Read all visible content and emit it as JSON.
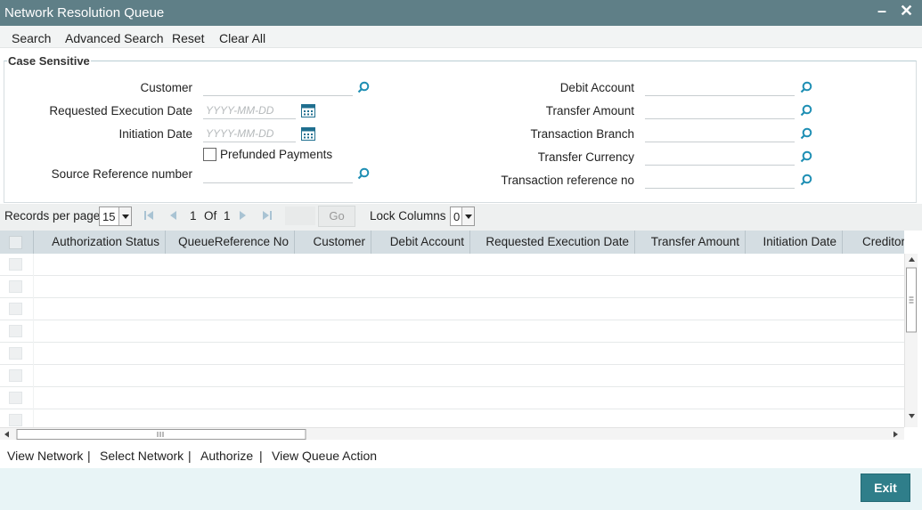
{
  "window": {
    "title": "Network Resolution Queue",
    "minimize": "–",
    "close": "✕"
  },
  "menu": {
    "search": "Search",
    "advanced_search": "Advanced Search",
    "reset": "Reset",
    "clear_all": "Clear All"
  },
  "criteria": {
    "legend": "Case Sensitive",
    "customer": {
      "label": "Customer",
      "value": ""
    },
    "requested_execution_date": {
      "label": "Requested Execution Date",
      "placeholder": "YYYY-MM-DD"
    },
    "initiation_date": {
      "label": "Initiation Date",
      "placeholder": "YYYY-MM-DD"
    },
    "prefunded_payments": {
      "label": "Prefunded Payments",
      "checked": false
    },
    "source_reference_number": {
      "label": "Source Reference number",
      "value": ""
    },
    "debit_account": {
      "label": "Debit Account",
      "value": ""
    },
    "transfer_amount": {
      "label": "Transfer Amount",
      "value": ""
    },
    "transaction_branch": {
      "label": "Transaction Branch",
      "value": ""
    },
    "transfer_currency": {
      "label": "Transfer Currency",
      "value": ""
    },
    "transaction_reference_no": {
      "label": "Transaction reference no",
      "value": ""
    }
  },
  "pagination": {
    "records_per_page_label": "Records per page",
    "records_per_page": "15",
    "current_page": "1",
    "of_label": "Of",
    "total_pages": "1",
    "go_label": "Go",
    "lock_columns_label": "Lock Columns",
    "lock_columns": "0"
  },
  "grid": {
    "columns": [
      "Authorization Status",
      "QueueReference No",
      "Customer",
      "Debit Account",
      "Requested Execution Date",
      "Transfer Amount",
      "Initiation Date",
      "Creditor"
    ],
    "rows": []
  },
  "actions": {
    "view_network": "View Network",
    "select_network": "Select Network",
    "authorize": "Authorize",
    "view_queue_action": "View Queue Action",
    "separator": "|"
  },
  "footer": {
    "exit": "Exit"
  },
  "colors": {
    "titlebar": "#5f7f87",
    "accent": "#2f7e8a",
    "grid_header": "#d4dde2",
    "lookup_icon": "#1f8fb4"
  }
}
